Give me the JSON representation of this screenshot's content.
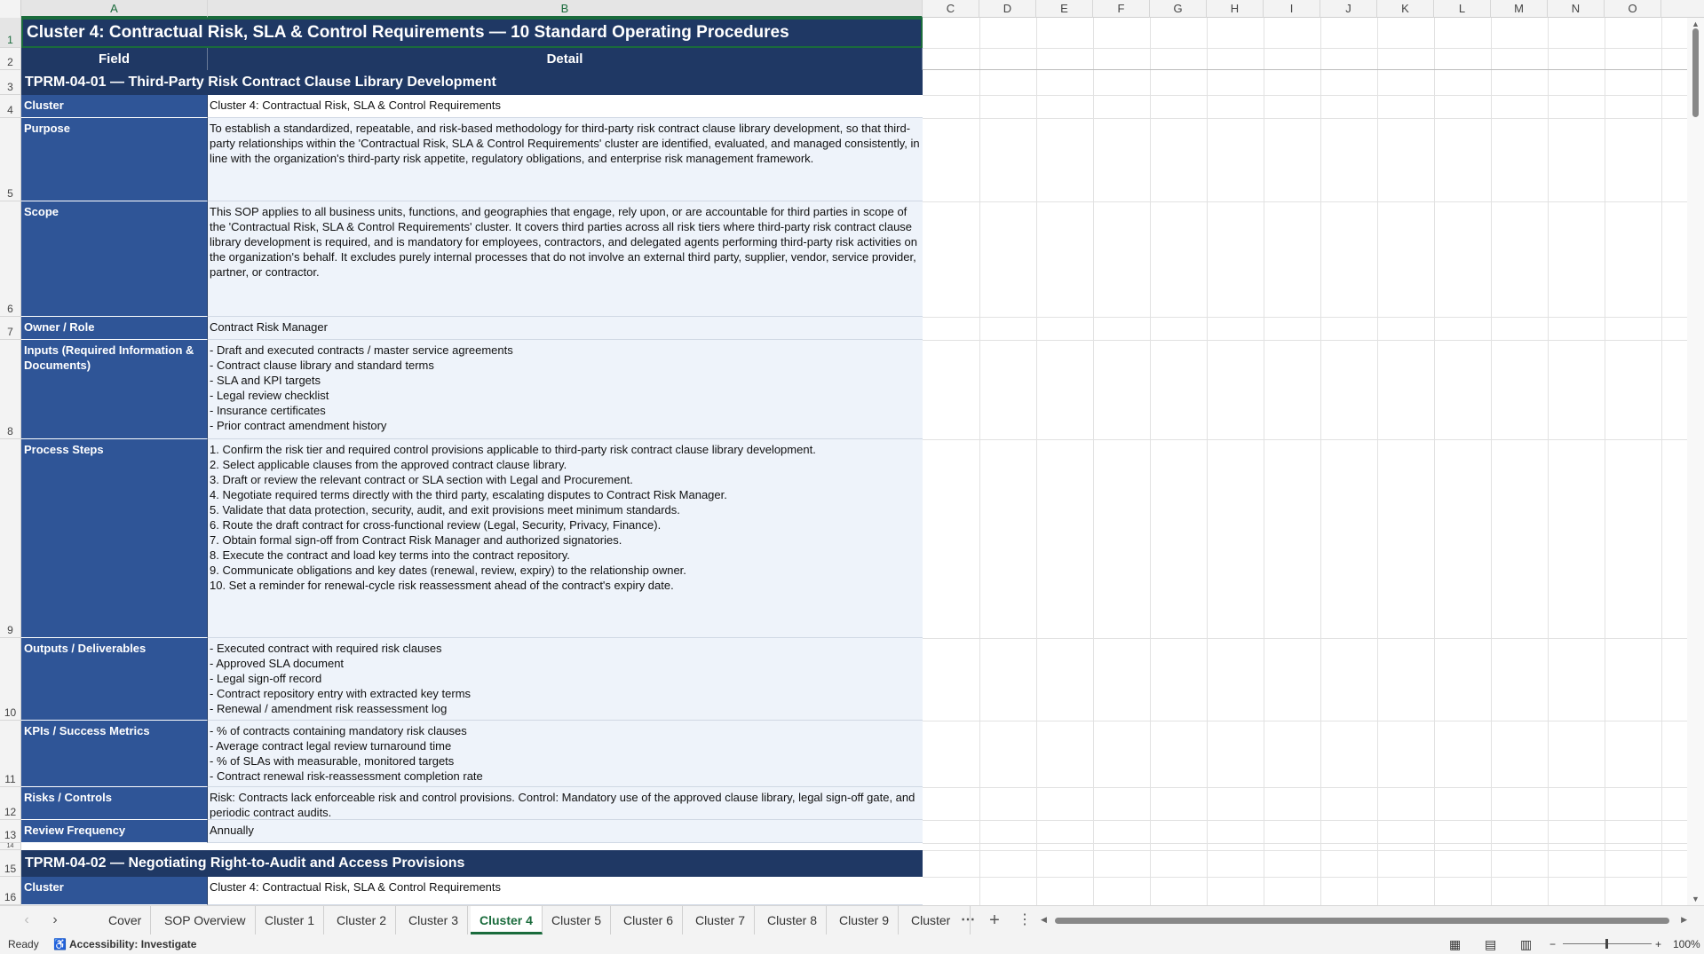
{
  "columns": [
    "A",
    "B",
    "C",
    "D",
    "E",
    "F",
    "G",
    "H",
    "I",
    "J",
    "K",
    "L",
    "M",
    "N",
    "O"
  ],
  "rows": [
    "1",
    "2",
    "3",
    "4",
    "5",
    "6",
    "7",
    "8",
    "9",
    "10",
    "11",
    "12",
    "13",
    "14",
    "15",
    "16"
  ],
  "sheet": {
    "title": "Cluster 4: Contractual Risk, SLA & Control Requirements  —  10 Standard Operating Procedures",
    "header_field": "Field",
    "header_detail": "Detail",
    "section1_title": "TPRM-04-01  —  Third-Party Risk Contract Clause Library Development",
    "rows": [
      {
        "field": "Cluster",
        "detail": "Cluster 4: Contractual Risk, SLA & Control Requirements"
      },
      {
        "field": "Purpose",
        "detail": "To establish a standardized, repeatable, and risk-based methodology for third-party risk contract clause library development, so that third-party relationships within the 'Contractual Risk, SLA & Control Requirements' cluster are identified, evaluated, and managed consistently, in line with the organization's third-party risk appetite, regulatory obligations, and enterprise risk management framework."
      },
      {
        "field": "Scope",
        "detail": "This SOP applies to all business units, functions, and geographies that engage, rely upon, or are accountable for third parties in scope of the 'Contractual Risk, SLA & Control Requirements' cluster. It covers third parties across all risk tiers where third-party risk contract clause library development is required, and is mandatory for employees, contractors, and delegated agents performing third-party risk activities on the organization's behalf. It excludes purely internal processes that do not involve an external third party, supplier, vendor, service provider, partner, or contractor."
      },
      {
        "field": "Owner / Role",
        "detail": "Contract Risk Manager"
      },
      {
        "field": "Inputs (Required Information & Documents)",
        "detail": "- Draft and executed contracts / master service agreements\n- Contract clause library and standard terms\n- SLA and KPI targets\n- Legal review checklist\n- Insurance certificates\n- Prior contract amendment history"
      },
      {
        "field": "Process Steps",
        "detail": "1. Confirm the risk tier and required control provisions applicable to third-party risk contract clause library development.\n2. Select applicable clauses from the approved contract clause library.\n3. Draft or review the relevant contract or SLA section with Legal and Procurement.\n4. Negotiate required terms directly with the third party, escalating disputes to Contract Risk Manager.\n5. Validate that data protection, security, audit, and exit provisions meet minimum standards.\n6. Route the draft contract for cross-functional review (Legal, Security, Privacy, Finance).\n7. Obtain formal sign-off from Contract Risk Manager and authorized signatories.\n8. Execute the contract and load key terms into the contract repository.\n9. Communicate obligations and key dates (renewal, review, expiry) to the relationship owner.\n10. Set a reminder for renewal-cycle risk reassessment ahead of the contract's expiry date."
      },
      {
        "field": "Outputs / Deliverables",
        "detail": "- Executed contract with required risk clauses\n- Approved SLA document\n- Legal sign-off record\n- Contract repository entry with extracted key terms\n- Renewal / amendment risk reassessment log"
      },
      {
        "field": "KPIs / Success Metrics",
        "detail": "- % of contracts containing mandatory risk clauses\n- Average contract legal review turnaround time\n- % of SLAs with measurable, monitored targets\n- Contract renewal risk-reassessment completion rate"
      },
      {
        "field": "Risks / Controls",
        "detail": "Risk: Contracts lack enforceable risk and control provisions. Control: Mandatory use of the approved clause library, legal sign-off gate, and periodic contract audits."
      },
      {
        "field": "Review Frequency",
        "detail": "Annually"
      }
    ],
    "section2_title": "TPRM-04-02  —  Negotiating Right-to-Audit and Access Provisions",
    "section2_rows": [
      {
        "field": "Cluster",
        "detail": "Cluster 4: Contractual Risk, SLA & Control Requirements"
      }
    ]
  },
  "tabs": [
    "Cover",
    "SOP Overview",
    "Cluster 1",
    "Cluster 2",
    "Cluster 3",
    "Cluster 4",
    "Cluster 5",
    "Cluster 6",
    "Cluster 7",
    "Cluster 8",
    "Cluster 9",
    "Cluster"
  ],
  "active_tab": "Cluster 4",
  "status": {
    "ready": "Ready",
    "accessibility": "Accessibility: Investigate",
    "zoom": "100%"
  },
  "colors": {
    "title_bg": "#1f3864",
    "field_bg": "#2f5597",
    "detail_bg": "#eef3fa",
    "accent": "#1a6b3c"
  }
}
